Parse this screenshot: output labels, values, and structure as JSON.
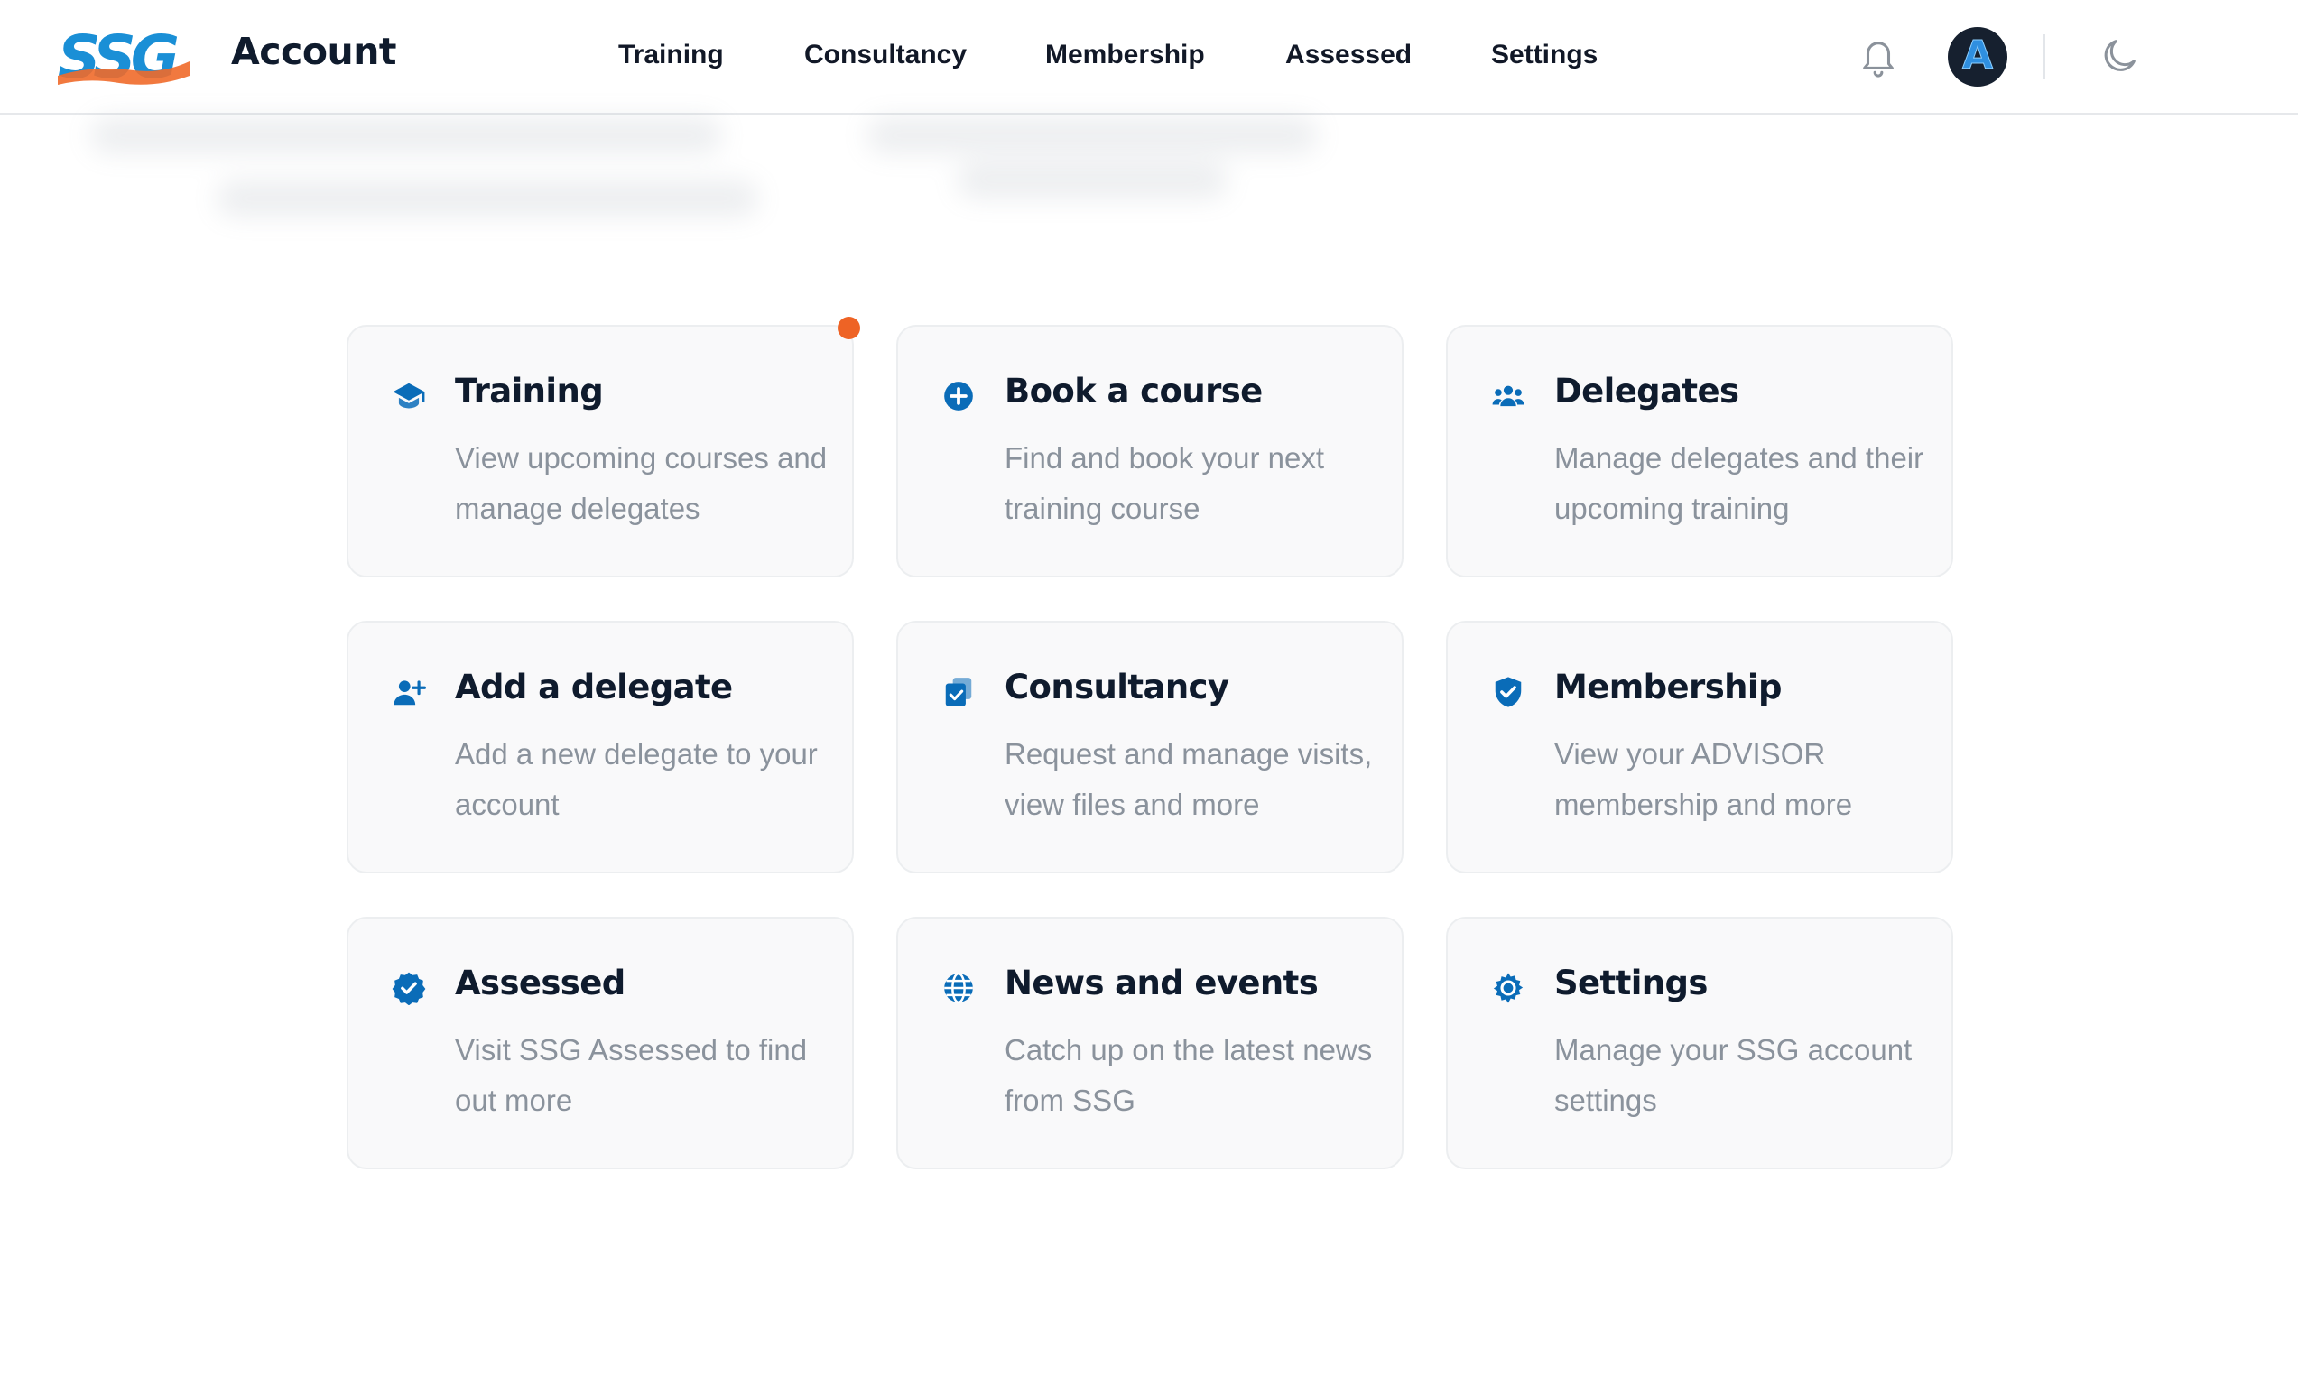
{
  "header": {
    "logo_text": "SSG",
    "title": "Account",
    "nav": [
      "Training",
      "Consultancy",
      "Membership",
      "Assessed",
      "Settings"
    ],
    "avatar_letter": "A",
    "icons": {
      "notifications": "bell-icon",
      "theme": "moon-icon"
    }
  },
  "cards": [
    {
      "title": "Training",
      "description": "View upcoming courses and manage delegates",
      "icon": "graduation-cap-icon",
      "has_notification": true
    },
    {
      "title": "Book a course",
      "description": "Find and book your next training course",
      "icon": "plus-circle-icon"
    },
    {
      "title": "Delegates",
      "description": "Manage delegates and their upcoming training",
      "icon": "users-icon"
    },
    {
      "title": "Add a delegate",
      "description": "Add a new delegate to your account",
      "icon": "user-plus-icon"
    },
    {
      "title": "Consultancy",
      "description": "Request and manage visits, view files and more",
      "icon": "clipboard-check-icon"
    },
    {
      "title": "Membership",
      "description": "View your ADVISOR membership and more",
      "icon": "shield-check-icon"
    },
    {
      "title": "Assessed",
      "description": "Visit SSG Assessed to find out more",
      "icon": "badge-check-icon"
    },
    {
      "title": "News and events",
      "description": "Catch up on the latest news from SSG",
      "icon": "globe-icon"
    },
    {
      "title": "Settings",
      "description": "Manage your SSG account settings",
      "icon": "gear-icon"
    }
  ],
  "colors": {
    "brand_blue": "#1a8fd6",
    "brand_orange": "#ef6a2a",
    "icon_blue": "#0a6cb8",
    "title_dark": "#0f1b2d",
    "desc_gray": "#8a929c",
    "notification": "#ee6325"
  }
}
